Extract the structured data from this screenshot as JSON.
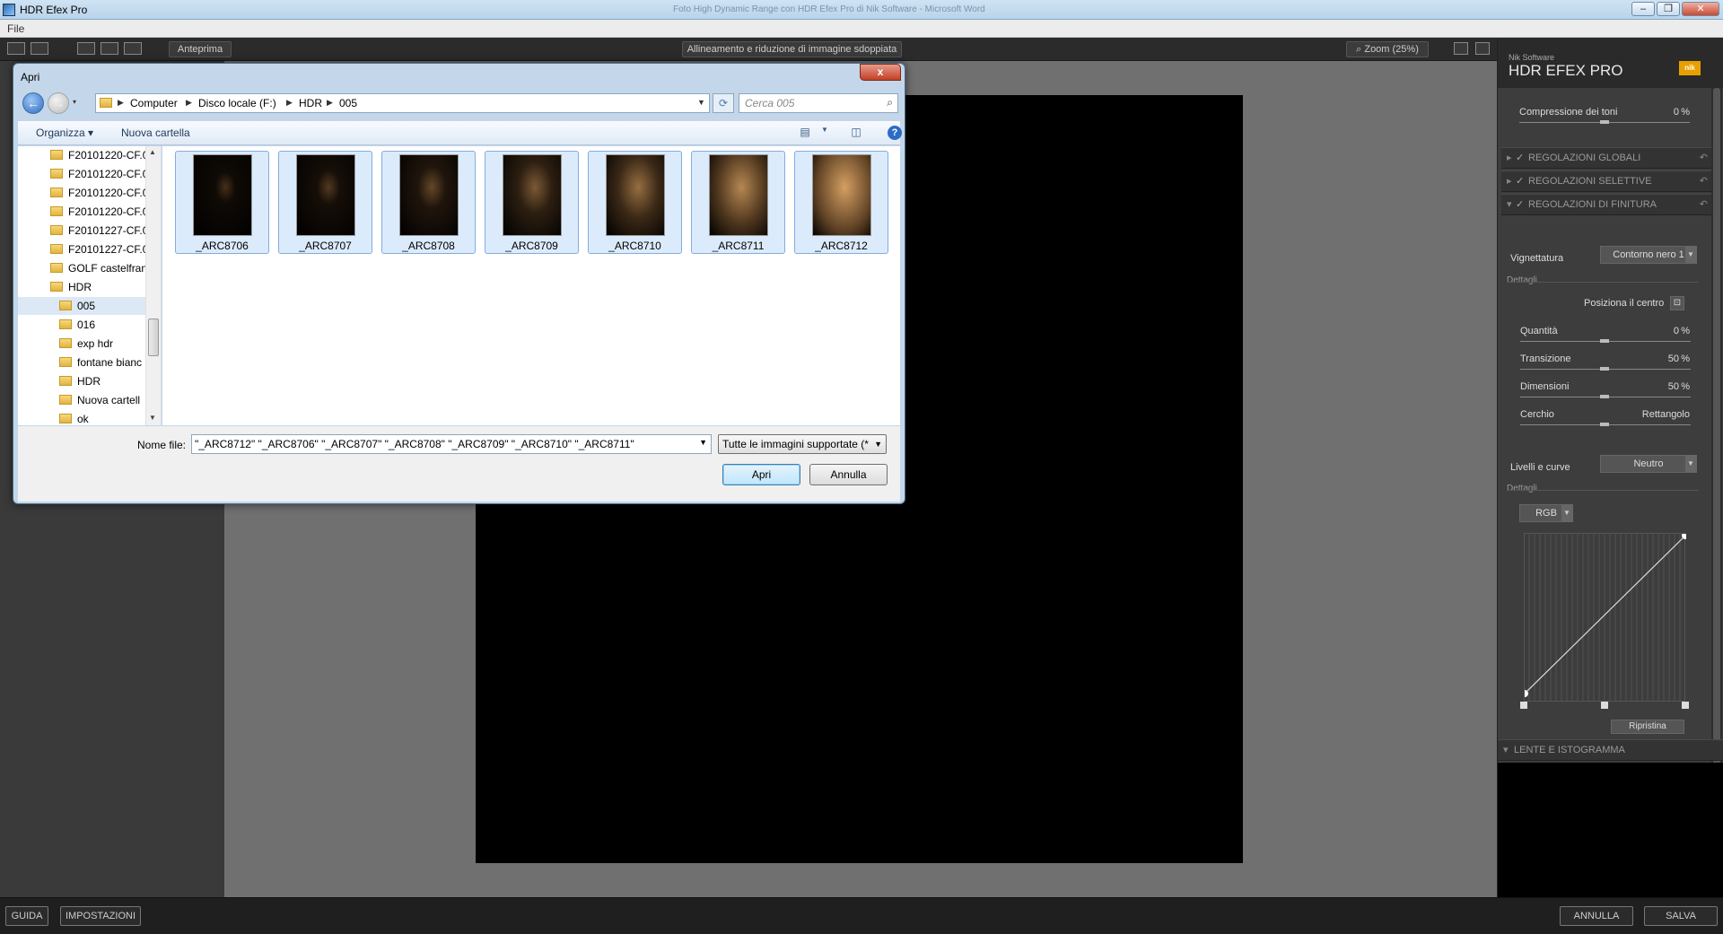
{
  "window": {
    "title": "HDR Efex Pro",
    "background_title": "Foto High Dynamic Range con HDR Efex Pro di Nik Software - Microsoft Word"
  },
  "menubar": {
    "file": "File"
  },
  "toolbar": {
    "preview_label": "Anteprima",
    "alignment_label": "Allineamento e riduzione di immagine sdoppiata",
    "zoom_label": "Zoom (25%)"
  },
  "right_panel": {
    "vendor": "Nik Software",
    "product": "HDR EFEX PRO",
    "tone_compression": {
      "label": "Compressione dei toni",
      "value": "0",
      "unit": "%"
    },
    "sections": [
      {
        "label": "REGOLAZIONI GLOBALI",
        "checked": true,
        "expanded": false
      },
      {
        "label": "REGOLAZIONI SELETTIVE",
        "checked": true,
        "expanded": false
      },
      {
        "label": "REGOLAZIONI DI FINITURA",
        "checked": true,
        "expanded": true
      }
    ],
    "vignette": {
      "label": "Vignettatura",
      "preset": "Contorno nero 1",
      "details_label": "Dettagli",
      "center_label": "Posiziona il centro",
      "amount": {
        "label": "Quantità",
        "value": "0",
        "unit": "%",
        "level": 0
      },
      "transition": {
        "label": "Transizione",
        "value": "50",
        "unit": "%",
        "level": 0.5
      },
      "size": {
        "label": "Dimensioni",
        "value": "50",
        "unit": "%",
        "level": 0.5
      },
      "circle": {
        "label": "Cerchio",
        "value": "Rettangolo",
        "level": 0.5
      }
    },
    "levels": {
      "label": "Livelli e curve",
      "preset": "Neutro",
      "details_label": "Dettagli",
      "channel": "RGB",
      "reset_label": "Ripristina"
    },
    "loupe_section": "LENTE E ISTOGRAMMA"
  },
  "bottom_bar": {
    "guide": "GUIDA",
    "settings": "IMPOSTAZIONI",
    "cancel": "ANNULLA",
    "save": "SALVA"
  },
  "dialog": {
    "title": "Apri",
    "close_label": "x",
    "breadcrumb": [
      "Computer",
      "Disco locale (F:)",
      "HDR",
      "005"
    ],
    "search_placeholder": "Cerca 005",
    "organize_label": "Organizza",
    "new_folder_label": "Nuova cartella",
    "tree": [
      {
        "label": "F20101220-CF.0",
        "indent": 1,
        "selected": false
      },
      {
        "label": "F20101220-CF.0",
        "indent": 1,
        "selected": false
      },
      {
        "label": "F20101220-CF.0",
        "indent": 1,
        "selected": false
      },
      {
        "label": "F20101220-CF.0",
        "indent": 1,
        "selected": false
      },
      {
        "label": "F20101227-CF.0",
        "indent": 1,
        "selected": false
      },
      {
        "label": "F20101227-CF.0",
        "indent": 1,
        "selected": false
      },
      {
        "label": "GOLF castelfran",
        "indent": 1,
        "selected": false
      },
      {
        "label": "HDR",
        "indent": 1,
        "selected": false
      },
      {
        "label": "005",
        "indent": 2,
        "selected": true
      },
      {
        "label": "016",
        "indent": 2,
        "selected": false
      },
      {
        "label": "exp hdr",
        "indent": 2,
        "selected": false
      },
      {
        "label": "fontane bianc",
        "indent": 2,
        "selected": false
      },
      {
        "label": "HDR",
        "indent": 2,
        "selected": false
      },
      {
        "label": "Nuova cartell",
        "indent": 2,
        "selected": false
      },
      {
        "label": "ok",
        "indent": 2,
        "selected": false
      }
    ],
    "files": [
      {
        "name": "_ARC8706",
        "brightness": 0.05
      },
      {
        "name": "_ARC8707",
        "brightness": 0.12
      },
      {
        "name": "_ARC8708",
        "brightness": 0.22
      },
      {
        "name": "_ARC8709",
        "brightness": 0.35
      },
      {
        "name": "_ARC8710",
        "brightness": 0.5
      },
      {
        "name": "_ARC8711",
        "brightness": 0.68
      },
      {
        "name": "_ARC8712",
        "brightness": 0.85
      }
    ],
    "filename_label": "Nome file:",
    "filename_value": "\"_ARC8712\" \"_ARC8706\" \"_ARC8707\" \"_ARC8708\" \"_ARC8709\" \"_ARC8710\" \"_ARC8711\"",
    "filter_label": "Tutte le immagini supportate (*",
    "open_label": "Apri",
    "cancel_label": "Annulla"
  }
}
